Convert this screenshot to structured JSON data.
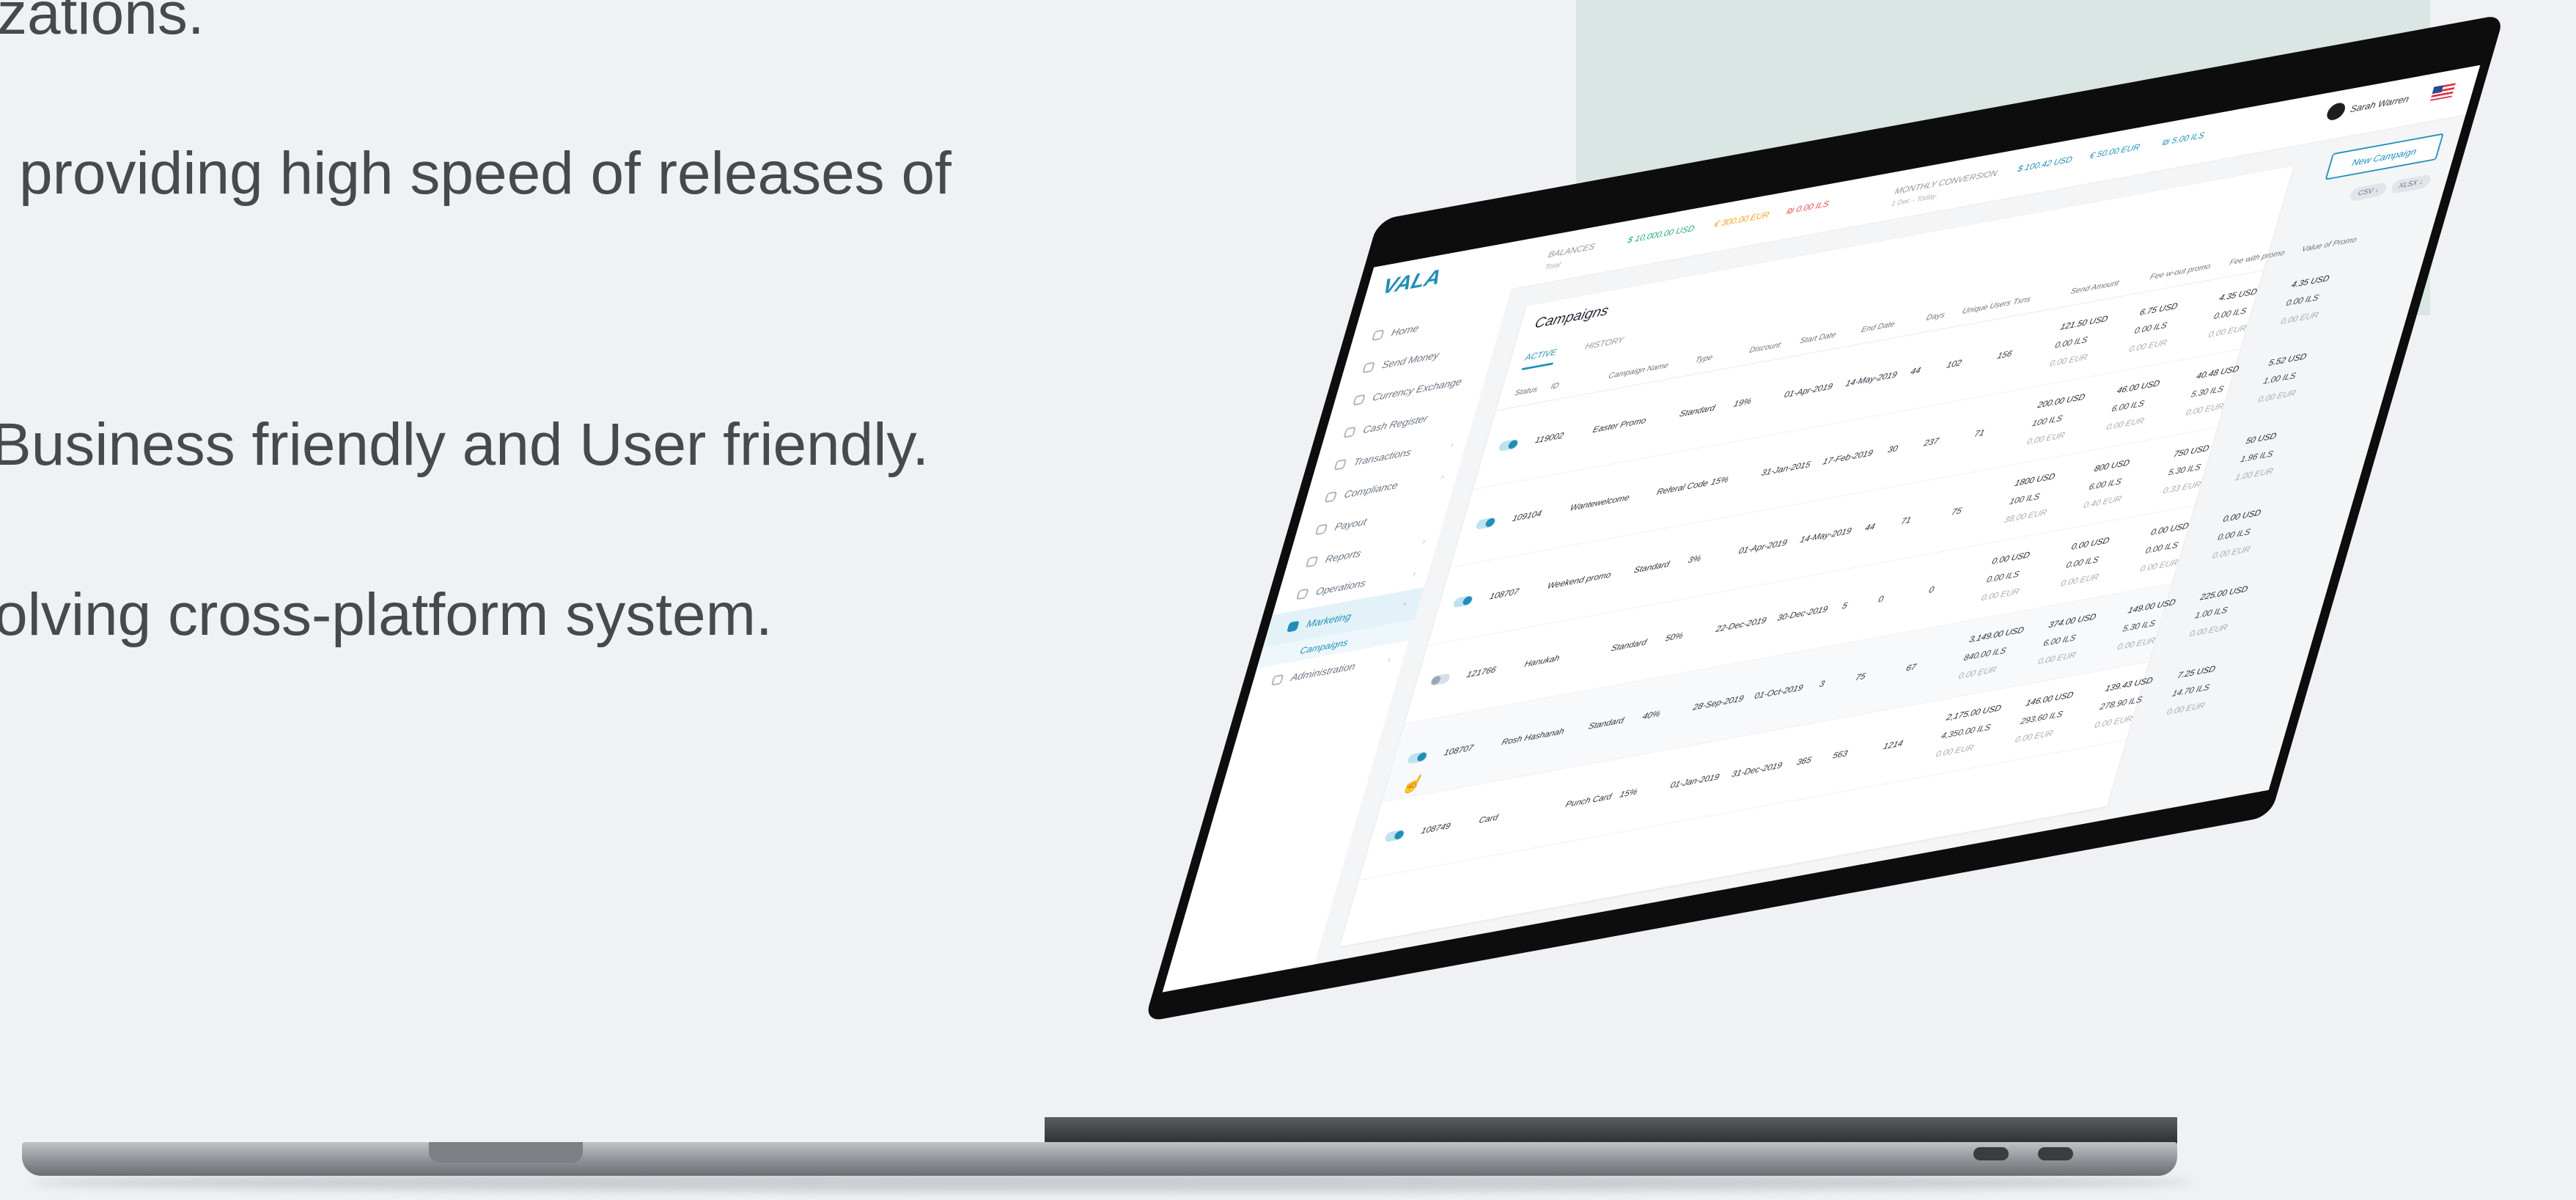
{
  "bullets": [
    "zations.",
    "providing high speed of releases of",
    "Business friendly and User friendly.",
    "olving cross-platform system."
  ],
  "app": {
    "logo": "VALA",
    "menu": [
      {
        "label": "Home",
        "chevron": ""
      },
      {
        "label": "Send Money",
        "chevron": ""
      },
      {
        "label": "Currency Exchange",
        "chevron": ""
      },
      {
        "label": "Cash Register",
        "chevron": ""
      },
      {
        "label": "Transactions",
        "chevron": "›"
      },
      {
        "label": "Compliance",
        "chevron": "›"
      },
      {
        "label": "Payout",
        "chevron": ""
      },
      {
        "label": "Reports",
        "chevron": "›"
      },
      {
        "label": "Operations",
        "chevron": "›"
      },
      {
        "label": "Marketing",
        "chevron": "⌃"
      },
      {
        "label": "Administration",
        "chevron": "›"
      }
    ],
    "submenu_campaigns": "Campaigns",
    "topbar": {
      "balances_label": "BALANCES",
      "balances_sub": "Total",
      "bal_usd": "$ 10,000.00 USD",
      "bal_eur": "€ 300.00 EUR",
      "bal_ils": "₪ 0.00 ILS",
      "conv_label": "MONTHLY CONVERSION",
      "conv_sub": "1 Dec - Today",
      "conv_usd": "$ 100.42 USD",
      "conv_eur": "€ 50.00 EUR",
      "conv_ils": "₪ 5.00 ILS",
      "user": "Sarah Warren"
    },
    "new_campaign": "New Campaign",
    "chips": [
      "CSV ↓",
      "XLSX ↓"
    ],
    "title": "Campaigns",
    "tabs": [
      "ACTIVE",
      "HISTORY"
    ],
    "columns": [
      "Status",
      "ID",
      "Campaign Name",
      "Type",
      "Discount",
      "Start Date",
      "End Date",
      "Days",
      "Unique Users",
      "Txns",
      "Send Amount",
      "Fee w-out promo",
      "Fee with promo",
      "Value of Promo"
    ],
    "rows": [
      {
        "on": true,
        "id": "119002",
        "name": "Easter Promo",
        "type": "Standard",
        "disc": "19%",
        "start": "01-Apr-2019",
        "end": "14-May-2019",
        "days": "44",
        "users": "102",
        "txns": "156",
        "send": [
          "121.50 USD",
          "0.00 ILS",
          "0.00 EUR"
        ],
        "feeOut": [
          "6.75 USD",
          "0.00 ILS",
          "0.00 EUR"
        ],
        "feeWith": [
          "4.35 USD",
          "0.00 ILS",
          "0.00 EUR"
        ],
        "value": [
          "4.35 USD",
          "0.00 ILS",
          "0.00 EUR"
        ]
      },
      {
        "on": true,
        "id": "109104",
        "name": "Wantewelcome",
        "type": "Referal Code",
        "disc": "15%",
        "start": "31-Jan-2015",
        "end": "17-Feb-2019",
        "days": "30",
        "users": "237",
        "txns": "71",
        "send": [
          "200.00 USD",
          "100 ILS",
          "0.00 EUR"
        ],
        "feeOut": [
          "46.00 USD",
          "6.00 ILS",
          "0.00 EUR"
        ],
        "feeWith": [
          "40.48 USD",
          "5.30 ILS",
          "0.00 EUR"
        ],
        "value": [
          "5.52 USD",
          "1.00 ILS",
          "0.00 EUR"
        ]
      },
      {
        "on": true,
        "id": "108707",
        "name": "Weekend promo",
        "type": "Standard",
        "disc": "3%",
        "start": "01-Apr-2019",
        "end": "14-May-2019",
        "days": "44",
        "users": "71",
        "txns": "75",
        "send": [
          "1800 USD",
          "100 ILS",
          "38.00 EUR"
        ],
        "feeOut": [
          "800 USD",
          "6.00 ILS",
          "0.40 EUR"
        ],
        "feeWith": [
          "750 USD",
          "5.30 ILS",
          "0.33 EUR"
        ],
        "value": [
          "50 USD",
          "1.96 ILS",
          "1.00 EUR"
        ]
      },
      {
        "on": false,
        "id": "121766",
        "name": "Hanukah",
        "type": "Standard",
        "disc": "50%",
        "start": "22-Dec-2019",
        "end": "30-Dec-2019",
        "days": "5",
        "users": "0",
        "txns": "0",
        "send": [
          "0.00 USD",
          "0.00 ILS",
          "0.00 EUR"
        ],
        "feeOut": [
          "0.00 USD",
          "0.00 ILS",
          "0.00 EUR"
        ],
        "feeWith": [
          "0.00 USD",
          "0.00 ILS",
          "0.00 EUR"
        ],
        "value": [
          "0.00 USD",
          "0.00 ILS",
          "0.00 EUR"
        ]
      },
      {
        "on": true,
        "id": "108707",
        "name": "Rosh Hashanah",
        "type": "Standard",
        "disc": "40%",
        "start": "28-Sep-2019",
        "end": "01-Oct-2019",
        "days": "3",
        "users": "75",
        "txns": "67",
        "send": [
          "3,149.00 USD",
          "840.00 ILS",
          "0.00 EUR"
        ],
        "feeOut": [
          "374.00 USD",
          "6.00 ILS",
          "0.00 EUR"
        ],
        "feeWith": [
          "149.00 USD",
          "5.30 ILS",
          "0.00 EUR"
        ],
        "value": [
          "225.00 USD",
          "1.00 ILS",
          "0.00 EUR"
        ]
      },
      {
        "on": true,
        "id": "108749",
        "name": "Card",
        "type": "Punch Card",
        "disc": "15%",
        "start": "01-Jan-2019",
        "end": "31-Dec-2019",
        "days": "365",
        "users": "563",
        "txns": "1214",
        "send": [
          "2,175.00 USD",
          "4,350.00 ILS",
          "0.00 EUR"
        ],
        "feeOut": [
          "146.00 USD",
          "293.60 ILS",
          "0.00 EUR"
        ],
        "feeWith": [
          "139.43 USD",
          "278.90 ILS",
          "0.00 EUR"
        ],
        "value": [
          "7.25 USD",
          "14.70 ILS",
          "0.00 EUR"
        ]
      }
    ]
  }
}
